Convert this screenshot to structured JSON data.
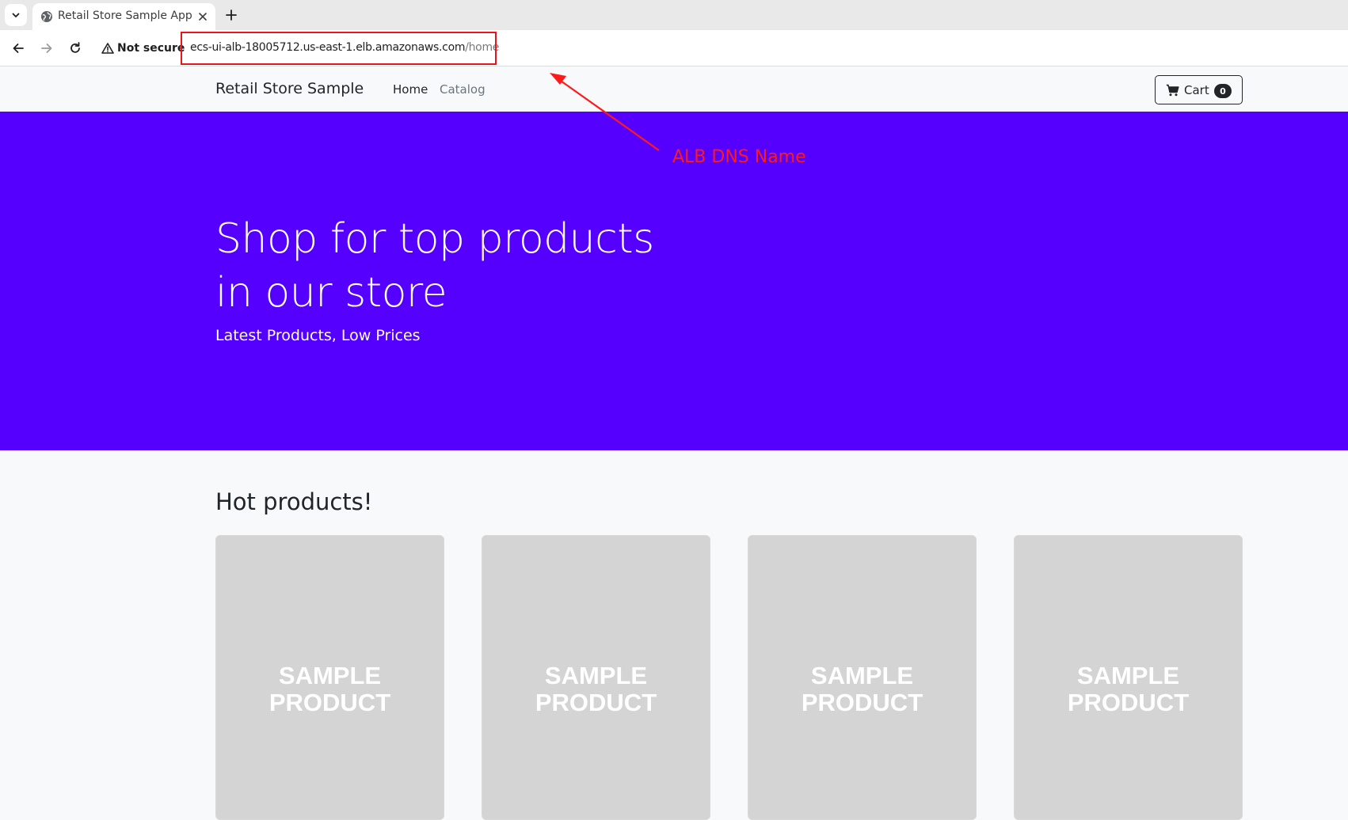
{
  "browser": {
    "tab": {
      "title": "Retail Store Sample App"
    },
    "address_bar": {
      "security_label": "Not secure",
      "url_host": "ecs-ui-alb-18005712.us-east-1.elb.amazonaws.com",
      "url_path": "/home"
    }
  },
  "site_nav": {
    "brand": "Retail Store Sample",
    "links": [
      "Home",
      "Catalog"
    ],
    "cart": {
      "label": "Cart",
      "count": "0"
    }
  },
  "hero": {
    "title_line1": "Shop for top products",
    "title_line2": "in our store",
    "subtitle": "Latest Products, Low Prices",
    "background_color": "#5500ff"
  },
  "annotation": {
    "label": "ALB DNS Name",
    "color": "#ff1a1a"
  },
  "hot_products": {
    "title": "Hot products!",
    "items": [
      {
        "image_line1": "SAMPLE",
        "image_line2": "PRODUCT"
      },
      {
        "image_line1": "SAMPLE",
        "image_line2": "PRODUCT"
      },
      {
        "image_line1": "SAMPLE",
        "image_line2": "PRODUCT"
      },
      {
        "image_line1": "SAMPLE",
        "image_line2": "PRODUCT"
      }
    ]
  },
  "icons": [
    "tab-dropdown-icon",
    "globe-icon",
    "close-icon",
    "plus-icon",
    "back-arrow-icon",
    "forward-arrow-icon",
    "reload-icon",
    "warning-icon",
    "cart-icon"
  ]
}
